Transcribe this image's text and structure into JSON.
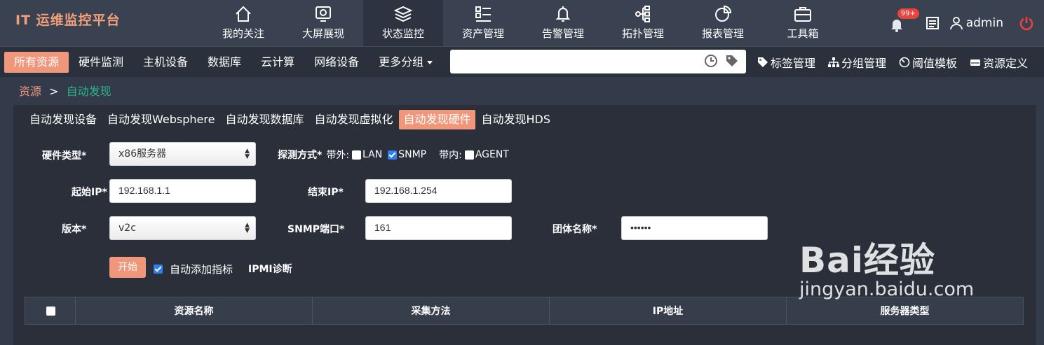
{
  "app": {
    "title": "IT 运维监控平台"
  },
  "nav": {
    "items": [
      {
        "label": "我的关注",
        "icon": "home-icon"
      },
      {
        "label": "大屏展现",
        "icon": "monitor-screen-icon"
      },
      {
        "label": "状态监控",
        "icon": "layers-icon",
        "active": true
      },
      {
        "label": "资产管理",
        "icon": "list-icon"
      },
      {
        "label": "告警管理",
        "icon": "bell-icon"
      },
      {
        "label": "拓扑管理",
        "icon": "topology-icon"
      },
      {
        "label": "报表管理",
        "icon": "pie-chart-icon"
      },
      {
        "label": "工具箱",
        "icon": "toolbox-icon"
      }
    ]
  },
  "topright": {
    "badge": "99+",
    "user": "admin"
  },
  "subbar": {
    "tabs": [
      "所有资源",
      "硬件监测",
      "主机设备",
      "数据库",
      "云计算",
      "网络设备",
      "更多分组"
    ],
    "search": {
      "value": "",
      "placeholder": ""
    },
    "tools": [
      "标签管理",
      "分组管理",
      "阈值模板",
      "资源定义"
    ]
  },
  "breadcrumb": {
    "root": "资源",
    "sep": ">",
    "current": "自动发现"
  },
  "discovery": {
    "tabs": [
      "自动发现设备",
      "自动发现Websphere",
      "自动发现数据库",
      "自动发现虚拟化",
      "自动发现硬件",
      "自动发现HDS"
    ],
    "active_tab": 4,
    "form": {
      "hw_type_label": "硬件类型*",
      "hw_type_value": "x86服务器",
      "probe_label": "探测方式*",
      "outband_label": "带外:",
      "lan_label": "LAN",
      "snmp_label": "SNMP",
      "inband_label": "带内:",
      "agent_label": "AGENT",
      "lan_checked": false,
      "snmp_checked": true,
      "agent_checked": false,
      "start_ip_label": "起始IP*",
      "start_ip_value": "192.168.1.1",
      "end_ip_label": "结束IP*",
      "end_ip_value": "192.168.1.254",
      "version_label": "版本*",
      "version_value": "v2c",
      "snmp_port_label": "SNMP端口*",
      "snmp_port_value": "161",
      "community_label": "团体名称*",
      "community_value": "••••••",
      "start_button": "开始",
      "auto_add_label": "自动添加指标",
      "auto_add_checked": true,
      "ipmi_label": "IPMI诊断"
    },
    "table": {
      "columns": [
        "资源名称",
        "采集方法",
        "IP地址",
        "服务器类型"
      ]
    }
  },
  "watermark": {
    "main": "Bai经验",
    "sub": "jingyan.baidu.com"
  },
  "colors": {
    "accent": "#f0967a",
    "logo": "#f0a07a",
    "link_green": "#2bb58a",
    "power": "#e8443c"
  }
}
